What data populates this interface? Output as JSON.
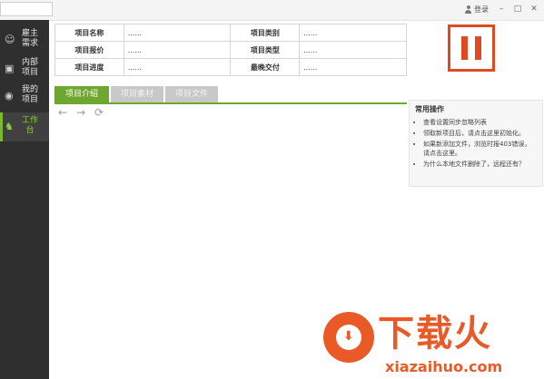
{
  "header": {
    "login_label": "登录",
    "minimize": "–",
    "maximize": "□",
    "close": "✕"
  },
  "sidebar": {
    "items": [
      {
        "label": "雇主需求",
        "icon": "user-icon"
      },
      {
        "label": "内部项目",
        "icon": "folder-icon"
      },
      {
        "label": "我的项目",
        "icon": "person-icon"
      },
      {
        "label": "工作台",
        "icon": "workbench-icon",
        "active": true
      }
    ]
  },
  "project_info": {
    "rows": [
      {
        "k1": "项目名称",
        "v1": "......",
        "k2": "项目类别",
        "v2": "......"
      },
      {
        "k1": "项目报价",
        "v1": "......",
        "k2": "项目类型",
        "v2": "......"
      },
      {
        "k1": "项目进度",
        "v1": "......",
        "k2": "最晚交付",
        "v2": "......"
      }
    ]
  },
  "tabs": [
    "项目介绍",
    "项目素材",
    "项目文件"
  ],
  "toolbar": {
    "back": "←",
    "forward": "→",
    "refresh": "⟳"
  },
  "common_ops": {
    "title": "常用操作",
    "items": [
      "查看设置同步忽略列表",
      "领取新项目后，请点击这里初始化。",
      "如果新添加文件，浏览时报403错误，请点击这里。",
      "为什么本地文件删除了，远程还有？"
    ]
  },
  "watermark": {
    "title": "下载火",
    "url": "xiazaihuo.com"
  },
  "colors": {
    "accent_green": "#6fa630",
    "accent_orange": "#e04a23",
    "sidebar_bg": "#2f2f2f"
  }
}
